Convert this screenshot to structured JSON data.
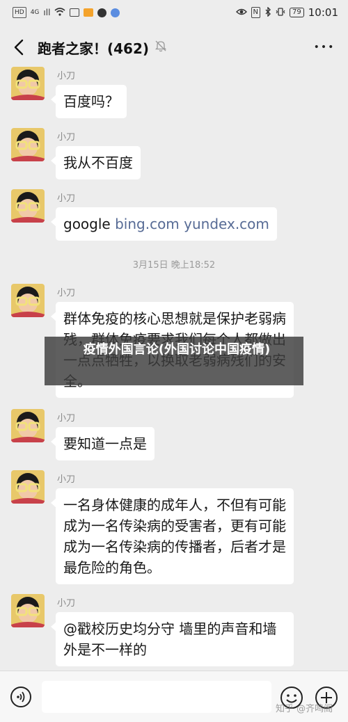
{
  "status_bar": {
    "network_left": "HD",
    "network_type": "4G",
    "signal": "ıll",
    "nfc": "N",
    "battery": "79",
    "time": "10:01"
  },
  "header": {
    "title": "跑者之家！(462)",
    "more": "•••"
  },
  "messages": [
    {
      "sender": "小刀",
      "text": "百度吗？"
    },
    {
      "sender": "小刀",
      "text": "我从不百度"
    },
    {
      "sender": "小刀",
      "text_plain": "google ",
      "text_link": "bing.com yundex.com"
    },
    {
      "sender": "小刀",
      "text": "群体免疫的核心思想就是保护老弱病残，群体免疫要求我们每个人都做出一点点牺牲，以换取老弱病残们的安全。"
    },
    {
      "sender": "小刀",
      "text": "要知道一点是"
    },
    {
      "sender": "小刀",
      "text": "一名身体健康的成年人，不但有可能成为一名传染病的受害者，更有可能成为一名传染病的传播者，后者才是最危险的角色。"
    },
    {
      "sender": "小刀",
      "text": "@戳校历史均分守  墙里的声音和墙外是不一样的"
    }
  ],
  "timestamp": "3月15日 晚上18:52",
  "overlay_title": "疫情外国言论(外国讨论中国疫情)",
  "watermark": "知乎 @齐鸣阁",
  "input": {
    "value": "",
    "placeholder": ""
  },
  "colors": {
    "background": "#ededed",
    "bubble": "#ffffff",
    "link": "#576b95"
  }
}
